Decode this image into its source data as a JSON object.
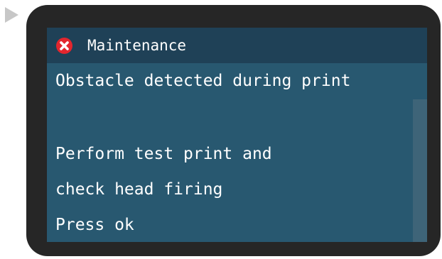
{
  "dialog": {
    "title": "Maintenance",
    "icon": "error-icon",
    "lines": [
      "Obstacle detected during print",
      "",
      "Perform test print and",
      "check head firing",
      "Press ok"
    ]
  },
  "colors": {
    "bezel": "#262626",
    "screen_background": "#285870",
    "title_bar": "#1f4157",
    "error": "#e3262e",
    "text": "#ffffff",
    "scrollbar": "#3e6478",
    "pointer": "#c7c7c7"
  }
}
